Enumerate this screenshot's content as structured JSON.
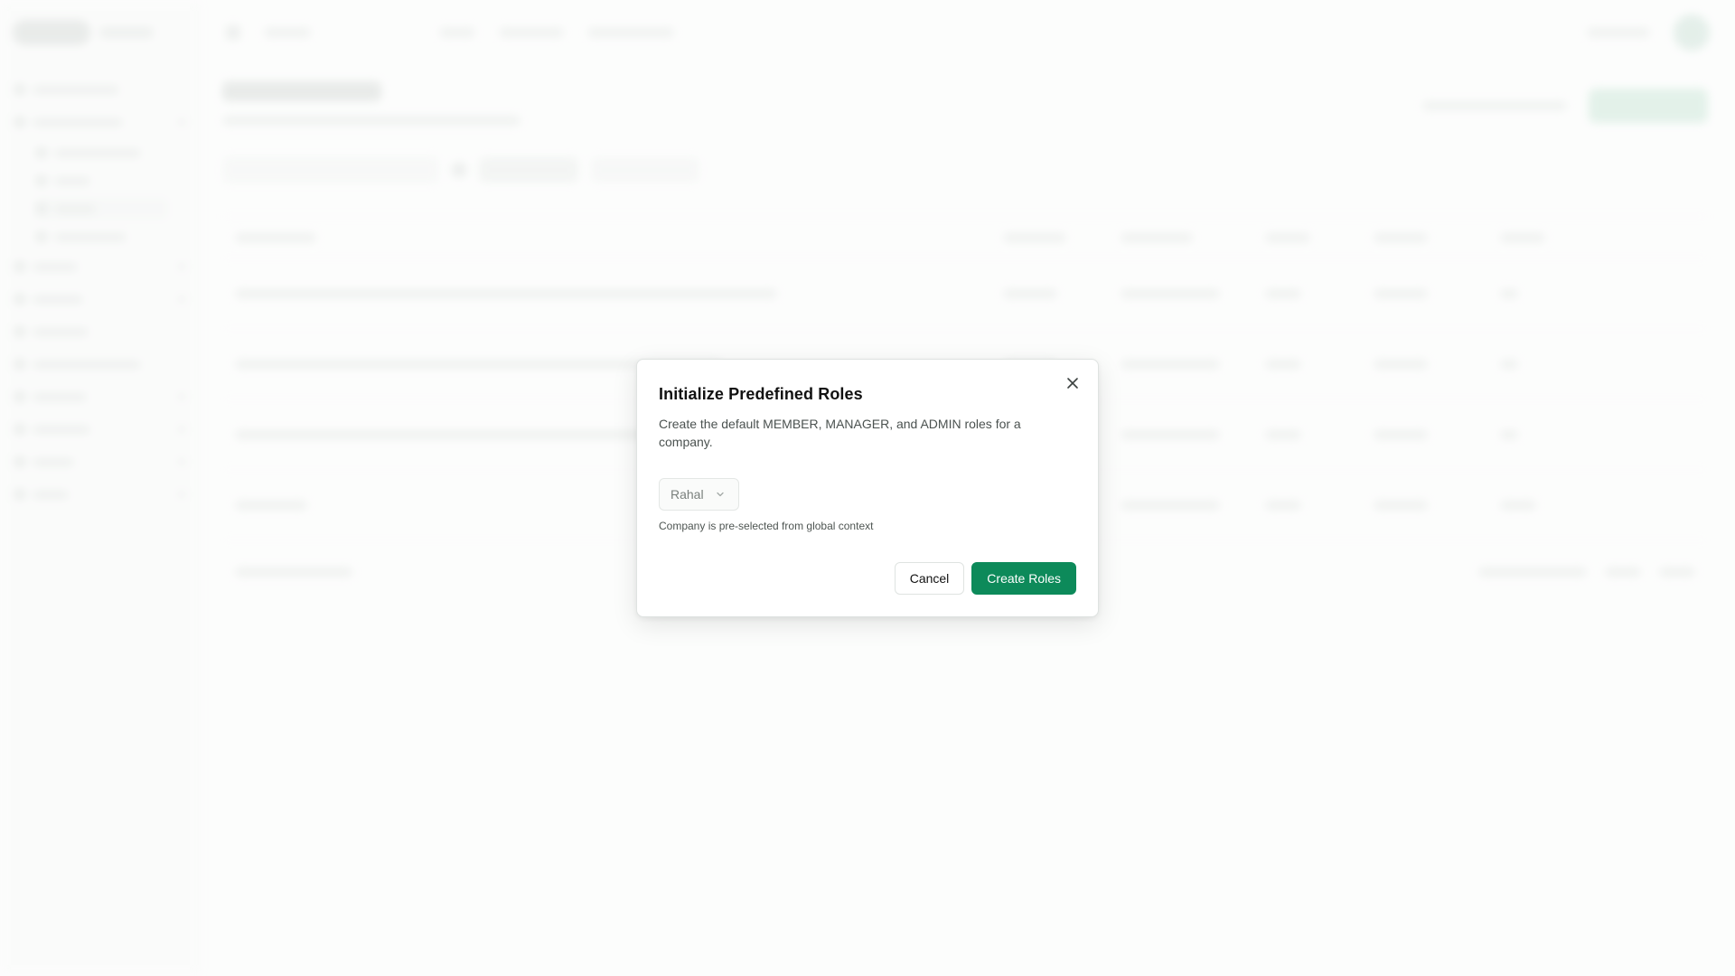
{
  "dialog": {
    "title": "Initialize Predefined Roles",
    "description": "Create the default MEMBER, MANAGER, and ADMIN roles for a company.",
    "company_select": {
      "value": "Rahal"
    },
    "helper_text": "Company is pre-selected from global context",
    "cancel_label": "Cancel",
    "submit_label": "Create Roles"
  },
  "colors": {
    "primary": "#0d8a5a",
    "dialog_bg": "#ffffff",
    "page_bg": "#fbfcfb"
  },
  "icons": {
    "close": "close-icon",
    "select": "chevron-down-icon"
  }
}
